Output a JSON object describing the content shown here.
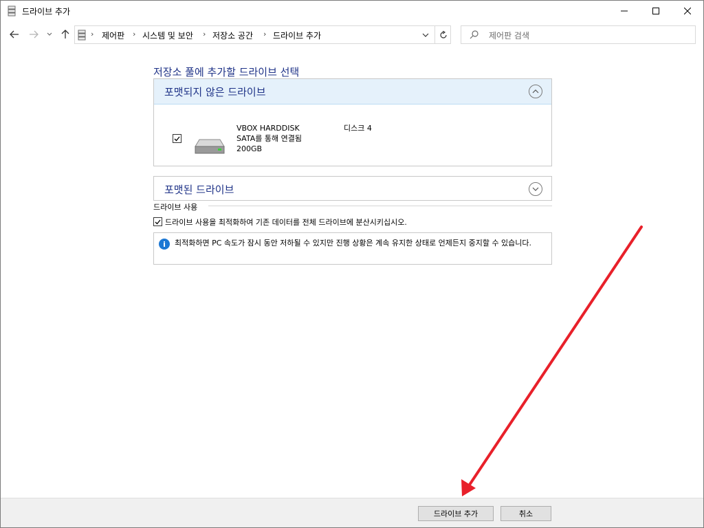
{
  "window": {
    "title": "드라이브 추가",
    "title_icon": "storage-spaces-icon"
  },
  "nav": {
    "breadcrumb": [
      "제어판",
      "시스템 및 보안",
      "저장소 공간",
      "드라이브 추가"
    ],
    "search_placeholder": "제어판 검색"
  },
  "main": {
    "heading": "저장소 풀에 추가할 드라이브 선택",
    "unformatted": {
      "title": "포맷되지 않은 드라이브",
      "expanded": true,
      "drives": [
        {
          "checked": true,
          "name": "VBOX HARDDISK",
          "connection": "SATA를 통해 연결됨",
          "size": "200GB",
          "disk": "디스크 4"
        }
      ]
    },
    "formatted": {
      "title": "포맷된 드라이브",
      "expanded": false
    },
    "usage": {
      "label": "드라이브 사용",
      "option_checked": true,
      "option_label": "드라이브 사용을 최적화하여 기존 데이터를 전체 드라이브에 분산시키십시오.",
      "info": "최적화하면 PC 속도가 잠시 동안 저하될 수 있지만 진행 상황은 계속 유지한 상태로 언제든지 중지할 수 있습니다."
    }
  },
  "footer": {
    "add_label": "드라이브 추가",
    "cancel_label": "취소"
  },
  "colors": {
    "accent_text": "#1e3287",
    "panel_header": "#e5f1fb",
    "annotation_arrow": "#e8202a"
  }
}
